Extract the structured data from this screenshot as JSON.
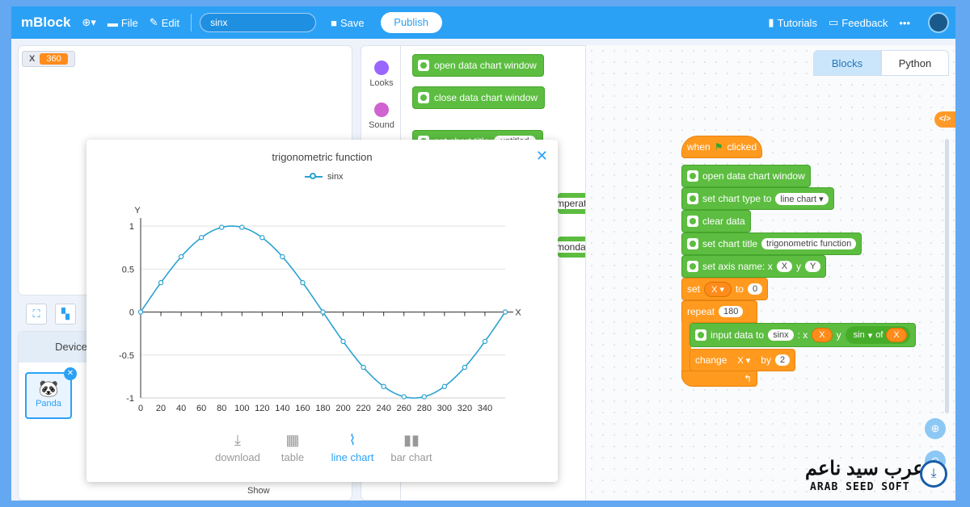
{
  "topbar": {
    "logo": "mBlock",
    "file_label": "File",
    "edit_label": "Edit",
    "project_name": "sinx",
    "save_label": "Save",
    "publish_label": "Publish",
    "tutorials_label": "Tutorials",
    "feedback_label": "Feedback",
    "more_label": "•••"
  },
  "stage": {
    "x_label": "X",
    "x_value": "360"
  },
  "devices": {
    "tab_label": "Device",
    "card_label": "Panda",
    "show_label": "Show"
  },
  "categories": [
    {
      "label": "Looks",
      "color": "#9966ff"
    },
    {
      "label": "Sound",
      "color": "#cf63cf"
    }
  ],
  "palette": {
    "blocks": [
      "open data chart window",
      "close data chart window",
      "set chart title"
    ],
    "title_pill": "untitled",
    "edge_fragments": [
      "mperat",
      "monday"
    ]
  },
  "code_tabs": {
    "blocks": "Blocks",
    "python": "Python"
  },
  "script": {
    "when": "when",
    "clicked": "clicked",
    "open": "open data chart window",
    "set_type": "set chart type to",
    "type_value": "line chart",
    "clear": "clear data",
    "set_title": "set chart title",
    "title_value": "trigonometric function",
    "set_axis": "set axis name: x",
    "axis_x": "X",
    "axis_y_label": "y",
    "axis_y": "Y",
    "set": "set",
    "set_var": "X",
    "to": "to",
    "set_value": "0",
    "repeat": "repeat",
    "repeat_value": "180",
    "input_data": "input data to",
    "input_series": "sinx",
    "input_x_label": ": x",
    "input_x": "X",
    "input_y_label": "y",
    "sin_fn": "sin",
    "of": "of",
    "sin_arg": "X",
    "change": "change",
    "change_var": "X",
    "by": "by",
    "change_value": "2"
  },
  "modal": {
    "actions": [
      {
        "label": "download",
        "icon": "⤓",
        "icon_name": "download-icon"
      },
      {
        "label": "table",
        "icon": "▦",
        "icon_name": "table-icon"
      },
      {
        "label": "line chart",
        "icon": "📈",
        "icon_name": "line-chart-icon"
      },
      {
        "label": "bar chart",
        "icon": "▮▮",
        "icon_name": "bar-chart-icon"
      }
    ]
  },
  "watermark": {
    "arabic": "عرب سيد ناعم",
    "english": "ARAB SEED SOFT"
  },
  "chart_data": {
    "type": "line",
    "title": "trigonometric function",
    "xlabel": "X",
    "ylabel": "Y",
    "series": [
      {
        "name": "sinx",
        "x": [
          0,
          20,
          40,
          60,
          80,
          100,
          120,
          140,
          160,
          180,
          200,
          220,
          240,
          260,
          280,
          300,
          320,
          340,
          360
        ],
        "y": [
          0,
          0.342,
          0.643,
          0.866,
          0.985,
          0.985,
          0.866,
          0.643,
          0.342,
          0,
          -0.342,
          -0.643,
          -0.866,
          -0.985,
          -0.985,
          -0.866,
          -0.643,
          -0.342,
          0
        ]
      }
    ],
    "x_ticks": [
      0,
      20,
      40,
      60,
      80,
      100,
      120,
      140,
      160,
      180,
      200,
      220,
      240,
      260,
      280,
      300,
      320,
      340
    ],
    "y_ticks": [
      1,
      0.5,
      0,
      -0.5,
      -1
    ],
    "xlim": [
      0,
      360
    ],
    "ylim": [
      -1,
      1
    ],
    "grid": true,
    "legend": "top-center",
    "line_color": "#2ba1d0"
  }
}
